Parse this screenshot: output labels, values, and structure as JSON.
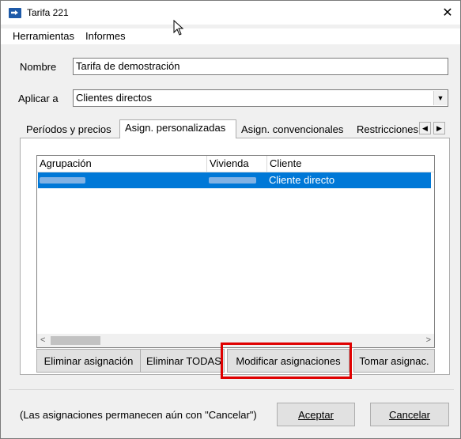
{
  "window": {
    "title": "Tarifa 221",
    "close_glyph": "✕"
  },
  "menu": [
    "Herramientas",
    "Informes"
  ],
  "form": {
    "nombre_label": "Nombre",
    "nombre_value": "Tarifa de demostración",
    "aplicar_label": "Aplicar a",
    "aplicar_value": "Clientes directos"
  },
  "tabs": [
    {
      "label": "Períodos y precios",
      "active": false
    },
    {
      "label": "Asign. personalizadas",
      "active": true
    },
    {
      "label": "Asign. convencionales",
      "active": false
    },
    {
      "label": "Restricciones",
      "active": false
    }
  ],
  "table": {
    "columns": [
      "Agrupación",
      "Vivienda",
      "Cliente"
    ],
    "rows": [
      {
        "agrupacion": "",
        "vivienda": "",
        "cliente": "Cliente directo",
        "selected": true
      }
    ]
  },
  "buttons": {
    "eliminar": "Eliminar asignación",
    "eliminar_todas": "Eliminar TODAS",
    "modificar": "Modificar asignaciones",
    "tomar": "Tomar asignac."
  },
  "footer": {
    "note": "(Las asignaciones permanecen aún con \"Cancelar\")",
    "aceptar": "Aceptar",
    "cancelar": "Cancelar"
  },
  "colors": {
    "selection": "#0078d7",
    "highlight_box": "#e00000"
  },
  "icons": [
    "app-icon",
    "close-icon",
    "dropdown-arrow-icon",
    "tab-scroll-left-icon",
    "tab-scroll-right-icon",
    "scroll-left-icon",
    "scroll-right-icon",
    "mouse-cursor-icon"
  ]
}
